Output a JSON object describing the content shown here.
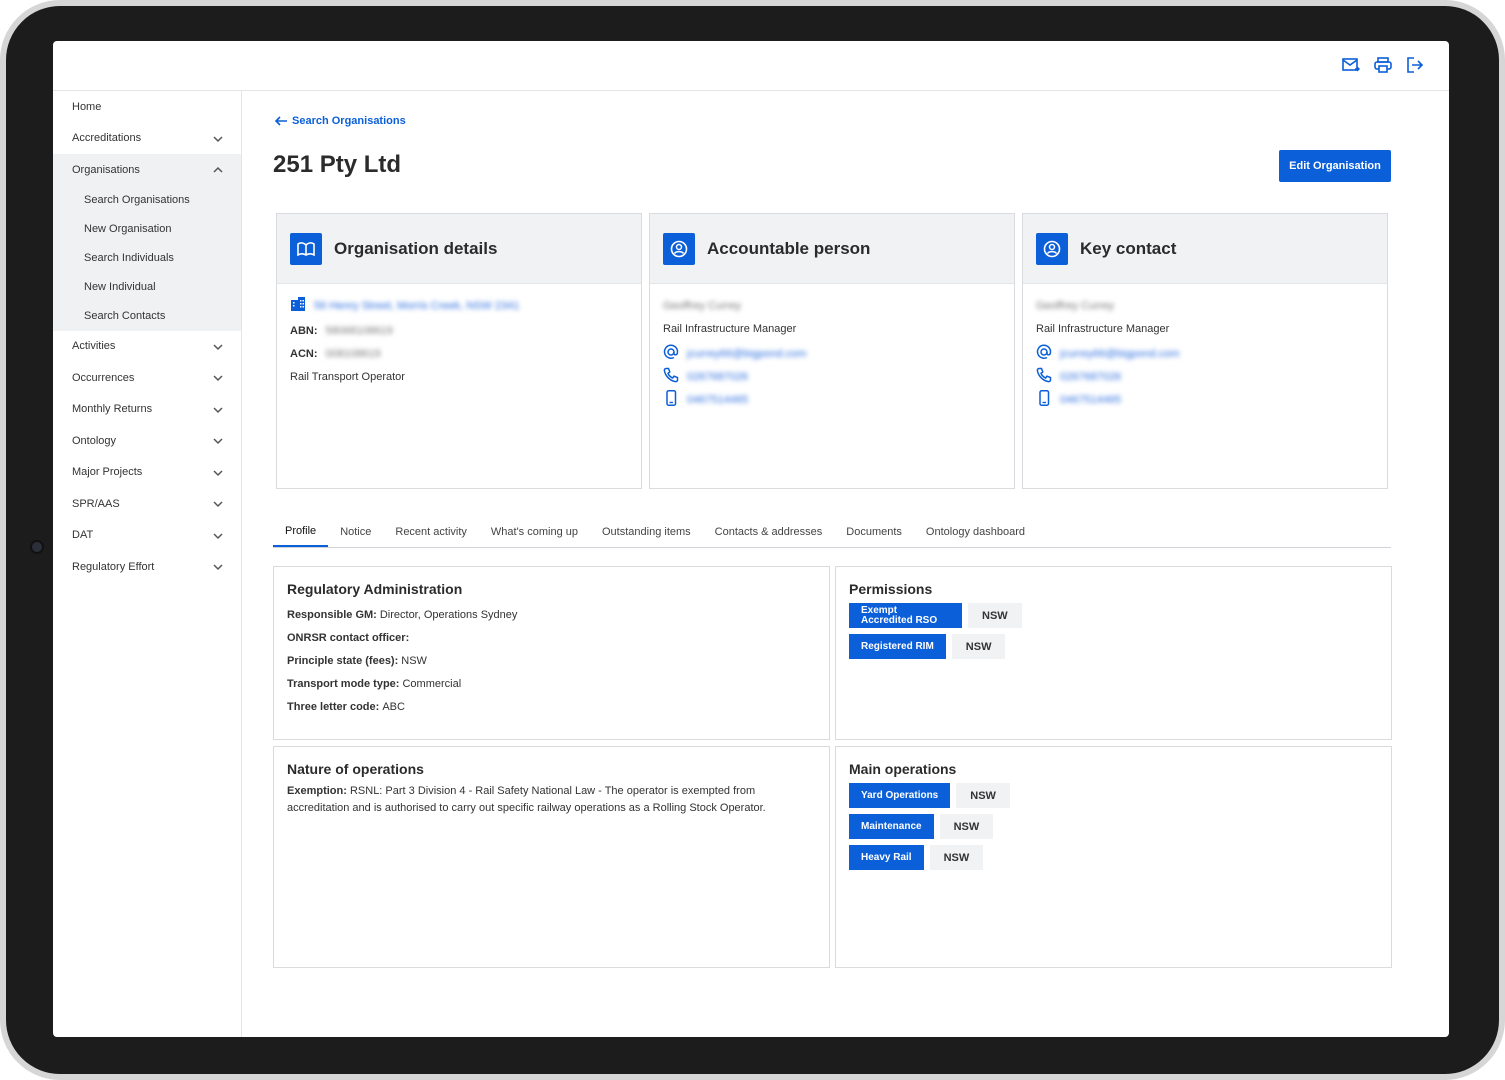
{
  "sidebar": {
    "items": [
      {
        "label": "Home",
        "chevron": false
      },
      {
        "label": "Accreditations",
        "chevron": true
      },
      {
        "label": "Organisations",
        "chevron": true,
        "expanded": true,
        "children": [
          "Search Organisations",
          "New Organisation",
          "Search Individuals",
          "New Individual",
          "Search Contacts"
        ]
      },
      {
        "label": "Activities",
        "chevron": true
      },
      {
        "label": "Occurrences",
        "chevron": true
      },
      {
        "label": "Monthly Returns",
        "chevron": true
      },
      {
        "label": "Ontology",
        "chevron": true
      },
      {
        "label": "Major Projects",
        "chevron": true
      },
      {
        "label": "SPR/AAS",
        "chevron": true
      },
      {
        "label": "DAT",
        "chevron": true
      },
      {
        "label": "Regulatory Effort",
        "chevron": true
      }
    ]
  },
  "header": {
    "back_label": "Search Organisations",
    "title": "251 Pty Ltd",
    "edit_button": "Edit Organisation"
  },
  "cards": {
    "org": {
      "title": "Organisation details",
      "address": "56 Henry Street, Morris Creek, NSW 2341",
      "abn_label": "ABN:",
      "abn": "58068108619",
      "acn_label": "ACN:",
      "acn": "008108619",
      "type": "Rail Transport Operator"
    },
    "accountable": {
      "title": "Accountable person",
      "name": "Geoffrey Currey",
      "role": "Rail Infrastructure Manager",
      "email": "jcurrey66@bigpond.com",
      "phone": "0267687026",
      "mobile": "0467514465"
    },
    "key": {
      "title": "Key contact",
      "name": "Geoffrey Currey",
      "role": "Rail Infrastructure Manager",
      "email": "jcurrey66@bigpond.com",
      "phone": "0267687026",
      "mobile": "0467514465"
    }
  },
  "tabs": [
    "Profile",
    "Notice",
    "Recent activity",
    "What's coming up",
    "Outstanding items",
    "Contacts & addresses",
    "Documents",
    "Ontology dashboard"
  ],
  "regulatory": {
    "title": "Regulatory Administration",
    "fields": [
      {
        "label": "Responsible GM:",
        "value": "Director, Operations Sydney"
      },
      {
        "label": "ONRSR contact officer:",
        "value": ""
      },
      {
        "label": "Principle state (fees):",
        "value": "NSW"
      },
      {
        "label": "Transport mode type:",
        "value": "Commercial"
      },
      {
        "label": "Three letter code:",
        "value": "ABC"
      }
    ]
  },
  "permissions": {
    "title": "Permissions",
    "items": [
      {
        "label": "Exempt Accredited RSO",
        "state": "NSW"
      },
      {
        "label": "Registered RIM",
        "state": "NSW"
      }
    ]
  },
  "nature": {
    "title": "Nature of operations",
    "label": "Exemption:",
    "text": "RSNL: Part 3 Division 4 - Rail Safety National Law - The operator is exempted from accreditation and is authorised to carry out specific railway operations as a Rolling Stock Operator."
  },
  "main_operations": {
    "title": "Main operations",
    "items": [
      {
        "label": "Yard Operations",
        "state": "NSW"
      },
      {
        "label": "Maintenance",
        "state": "NSW"
      },
      {
        "label": "Heavy Rail",
        "state": "NSW"
      }
    ]
  },
  "colors": {
    "accent": "#0b5fd8",
    "panel_bg": "#f1f2f4"
  }
}
